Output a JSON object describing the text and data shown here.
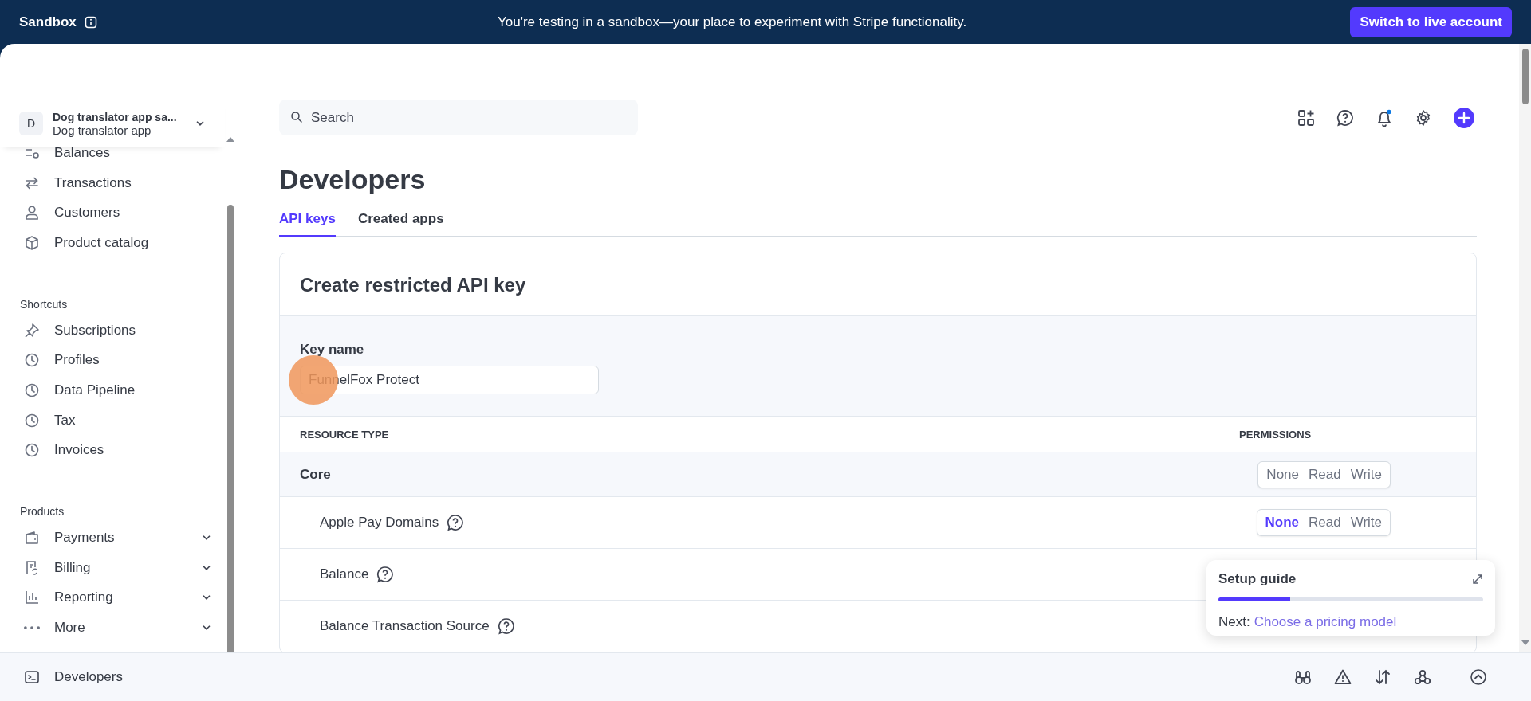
{
  "banner": {
    "label": "Sandbox",
    "message": "You're testing in a sandbox—your place to experiment with Stripe functionality.",
    "button": "Switch to live account"
  },
  "account": {
    "initial": "D",
    "name": "Dog translator app sa...",
    "subtitle": "Dog translator app"
  },
  "sidebar": {
    "sections": [
      {
        "items": [
          {
            "label": "Balances",
            "expandable": false
          },
          {
            "label": "Transactions",
            "expandable": false
          },
          {
            "label": "Customers",
            "expandable": false
          },
          {
            "label": "Product catalog",
            "expandable": false
          }
        ]
      },
      {
        "title": "Shortcuts",
        "items": [
          {
            "label": "Subscriptions",
            "expandable": false
          },
          {
            "label": "Profiles",
            "expandable": false
          },
          {
            "label": "Data Pipeline",
            "expandable": false
          },
          {
            "label": "Tax",
            "expandable": false
          },
          {
            "label": "Invoices",
            "expandable": false
          }
        ]
      },
      {
        "title": "Products",
        "items": [
          {
            "label": "Payments",
            "expandable": true
          },
          {
            "label": "Billing",
            "expandable": true
          },
          {
            "label": "Reporting",
            "expandable": true
          },
          {
            "label": "More",
            "expandable": true
          }
        ]
      }
    ]
  },
  "search": {
    "placeholder": "Search"
  },
  "header": {
    "notification": true
  },
  "page": {
    "title": "Developers",
    "tabs": [
      {
        "label": "API keys",
        "selected": true
      },
      {
        "label": "Created apps",
        "selected": false
      }
    ]
  },
  "card": {
    "title": "Create restricted API key",
    "key_label": "Key name",
    "key_value": "FunnelFox Protect",
    "columns": [
      "RESOURCE TYPE",
      "PERMISSIONS"
    ],
    "rows": [
      {
        "kind": "group",
        "label": "Core",
        "help": false,
        "options": [
          {
            "label": "None",
            "selected": false
          },
          {
            "label": "Read",
            "selected": false
          },
          {
            "label": "Write",
            "selected": false
          }
        ]
      },
      {
        "kind": "resource",
        "label": "Apple Pay Domains",
        "help": true,
        "options": [
          {
            "label": "None",
            "selected": true
          },
          {
            "label": "Read",
            "selected": false
          },
          {
            "label": "Write",
            "selected": false
          }
        ]
      },
      {
        "kind": "resource",
        "label": "Balance",
        "help": true
      },
      {
        "kind": "resource",
        "label": "Balance Transaction Source",
        "help": true
      }
    ]
  },
  "setup_guide": {
    "title": "Setup guide",
    "level": 0.27,
    "next_label": "Next:",
    "next_link": "Choose a pricing model"
  },
  "footer": {
    "label": "Developers"
  }
}
